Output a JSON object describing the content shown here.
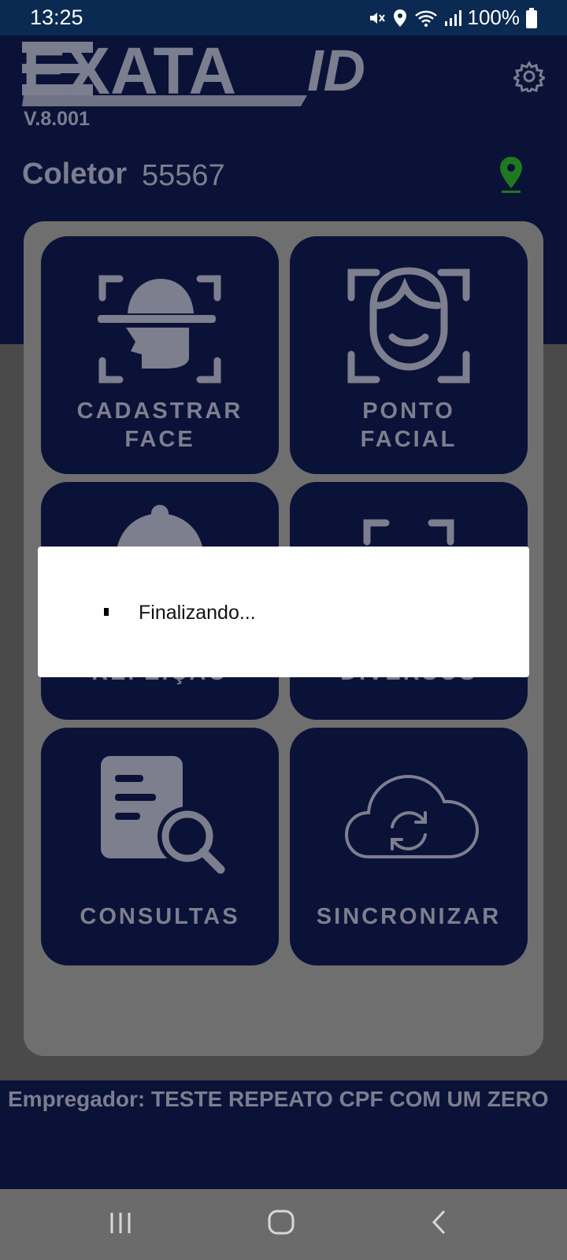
{
  "status_bar": {
    "time": "13:25",
    "battery": "100%",
    "icons": [
      "mute-icon",
      "location-icon",
      "wifi-icon",
      "signal-icon",
      "battery-icon"
    ]
  },
  "header": {
    "app_name": "EXATA",
    "app_suffix": "ID",
    "version": "V.8.001",
    "coletor_label": "Coletor",
    "coletor_value": "55567"
  },
  "tiles": [
    {
      "label_line1": "CADASTRAR",
      "label_line2": "FACE",
      "icon": "face-register-icon"
    },
    {
      "label_line1": "PONTO",
      "label_line2": "FACIAL",
      "icon": "face-scan-icon"
    },
    {
      "label_line1": "",
      "label_line2": "REFEIÇÃO",
      "icon": "meal-icon"
    },
    {
      "label_line1": "",
      "label_line2": "DIVERSOS",
      "icon": "misc-icon"
    },
    {
      "label_line1": "CONSULTAS",
      "label_line2": "",
      "icon": "search-document-icon"
    },
    {
      "label_line1": "SINCRONIZAR",
      "label_line2": "",
      "icon": "cloud-sync-icon"
    }
  ],
  "footer": {
    "empregador": "Empregador: TESTE REPEATO CPF COM UM ZERO"
  },
  "dialog": {
    "message": "Finalizando..."
  },
  "colors": {
    "navy": "#0b1238",
    "status_bar": "#0a2a52",
    "text_gray": "#7b7e8e",
    "pin_green": "#1f7a1f"
  }
}
